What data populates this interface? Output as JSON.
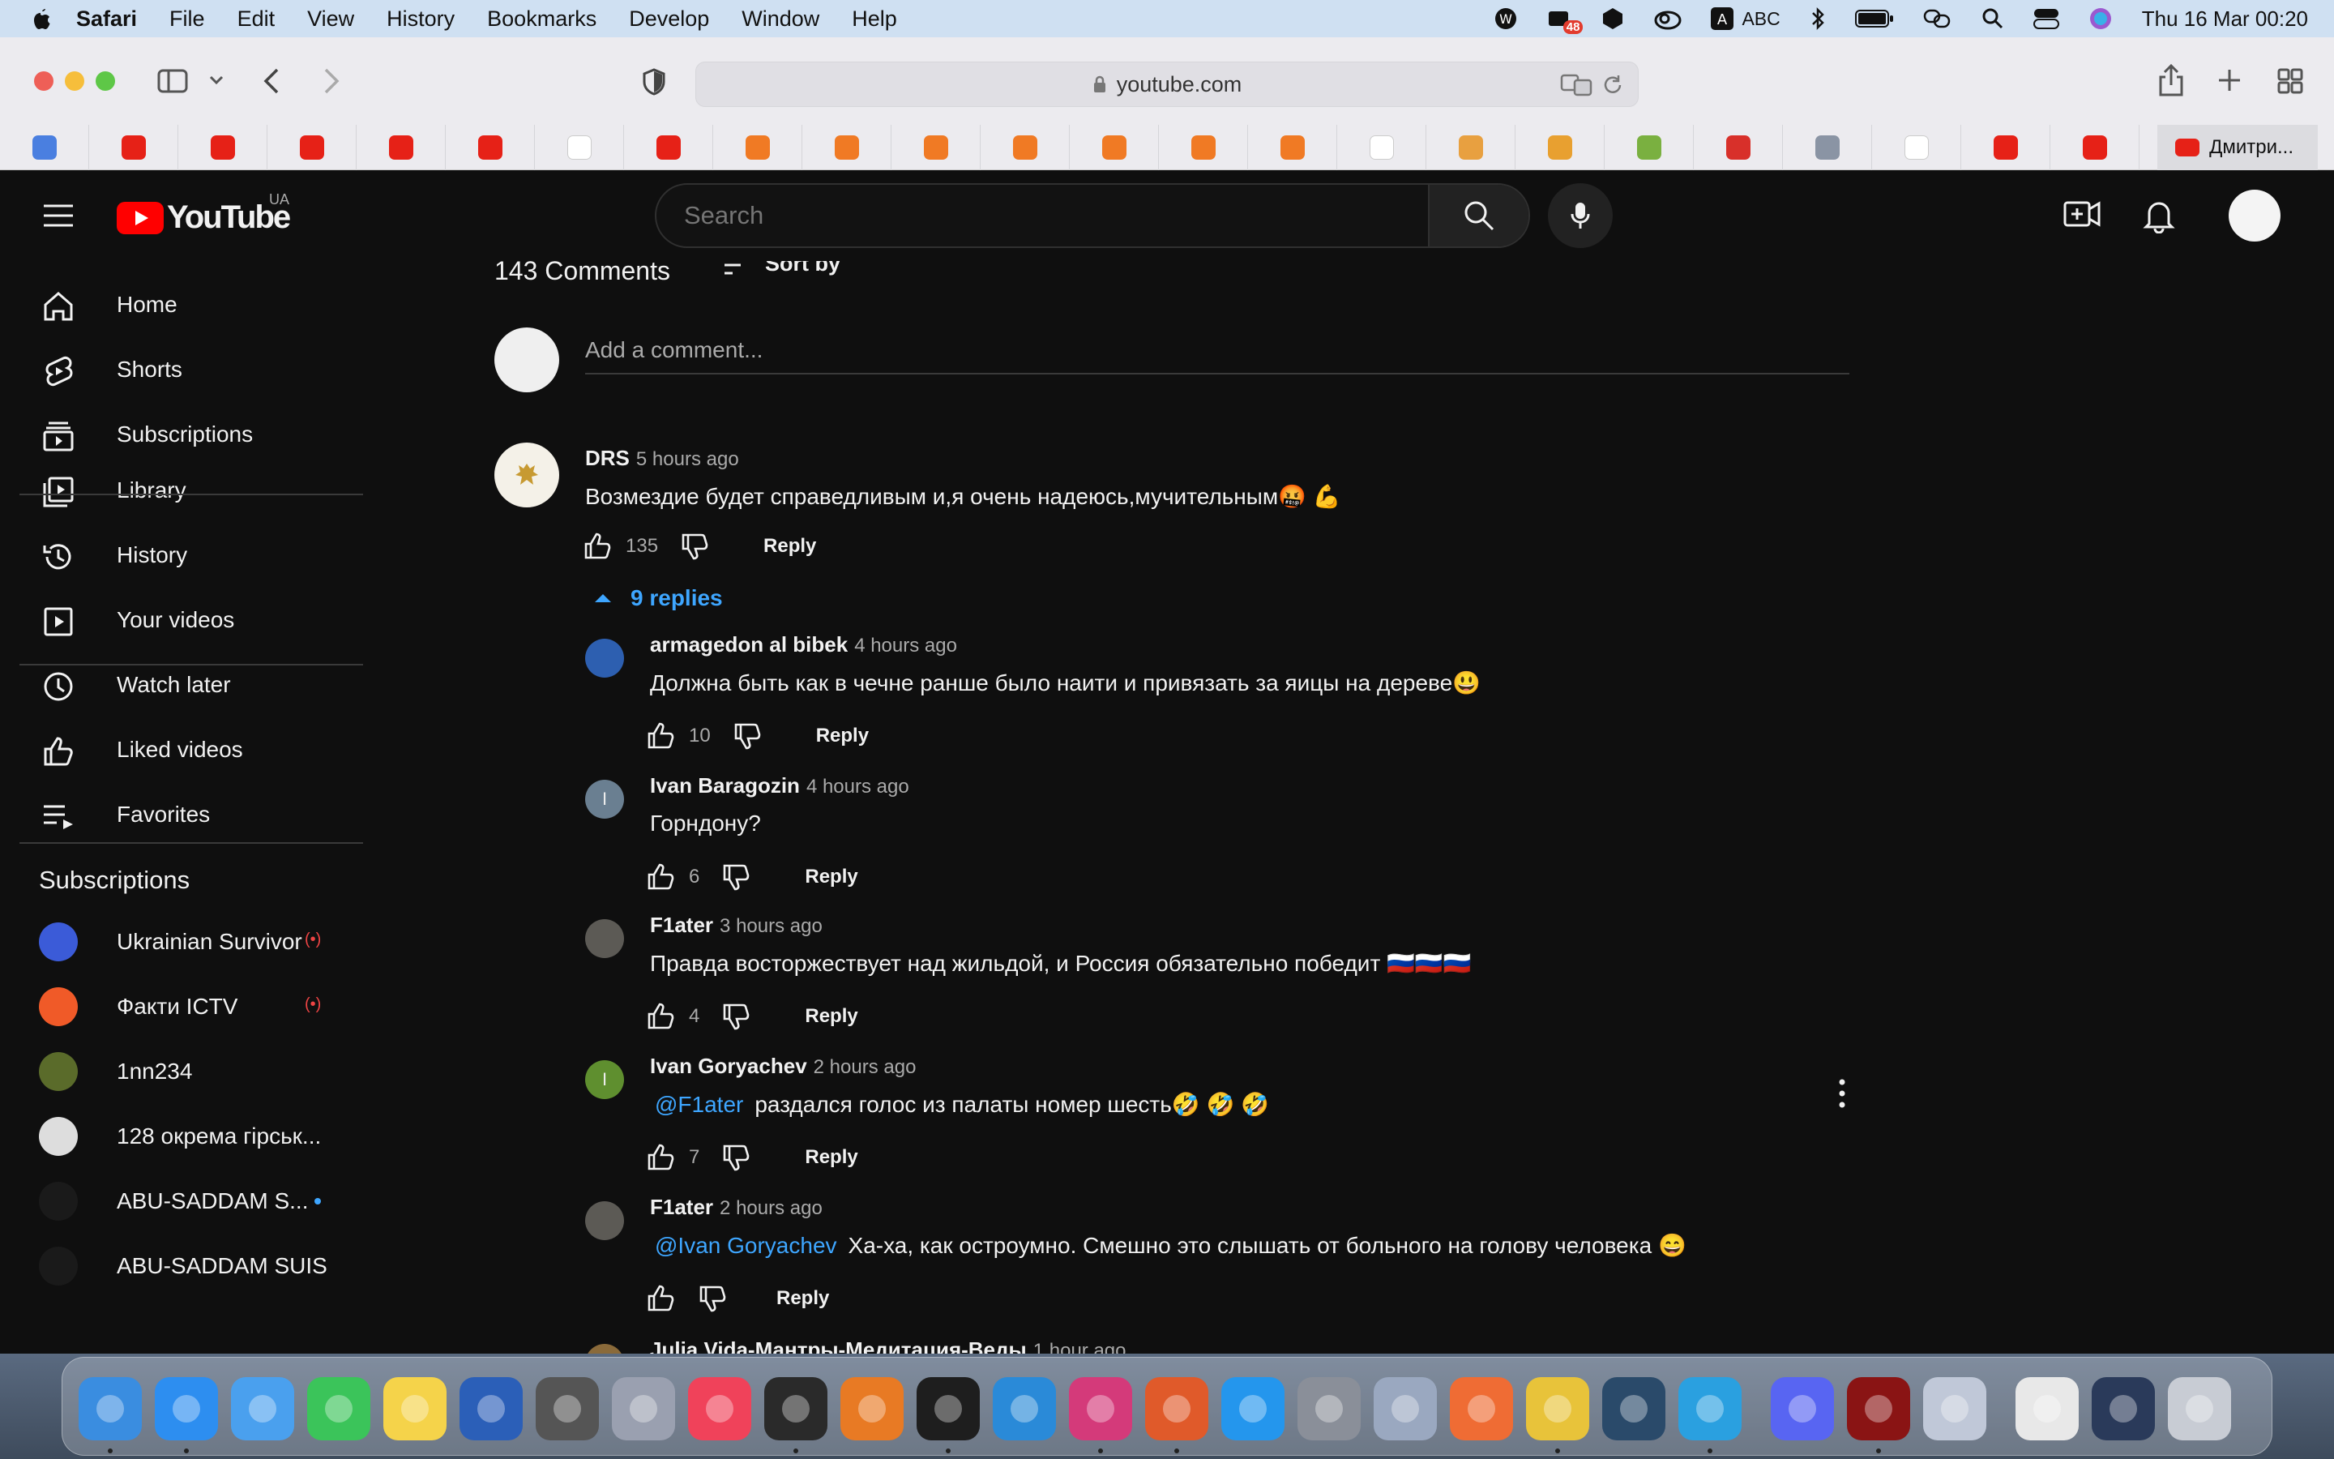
{
  "menubar": {
    "app": "Safari",
    "items": [
      "File",
      "Edit",
      "View",
      "History",
      "Bookmarks",
      "Develop",
      "Window",
      "Help"
    ],
    "keyboard": "ABC",
    "datetime": "Thu 16 Mar  00:20",
    "badge": "48"
  },
  "safari": {
    "url": "youtube.com",
    "bookmark_last": "Дмитри..."
  },
  "yt": {
    "logo": "YouTube",
    "country": "UA",
    "search_placeholder": "Search"
  },
  "sidebar": {
    "main": [
      {
        "label": "Home",
        "icon": "home-icon"
      },
      {
        "label": "Shorts",
        "icon": "shorts-icon"
      },
      {
        "label": "Subscriptions",
        "icon": "subscriptions-icon"
      }
    ],
    "you": [
      {
        "label": "Library",
        "icon": "library-icon"
      },
      {
        "label": "History",
        "icon": "history-icon"
      },
      {
        "label": "Your videos",
        "icon": "your-videos-icon"
      },
      {
        "label": "Watch later",
        "icon": "watch-later-icon"
      },
      {
        "label": "Liked videos",
        "icon": "liked-videos-icon"
      },
      {
        "label": "Favorites",
        "icon": "playlist-icon"
      }
    ],
    "subs_title": "Subscriptions",
    "subs": [
      {
        "label": "Ukrainian Survivor",
        "live": true,
        "color": "#3b5bd8"
      },
      {
        "label": "Факти ICTV",
        "live": true,
        "color": "#f05a28"
      },
      {
        "label": "1nn234",
        "live": false,
        "color": "#5a6b2a"
      },
      {
        "label": "128 окрема гірськ...",
        "live": false,
        "color": "#dddddd"
      },
      {
        "label": "ABU-SADDAM S...",
        "live": false,
        "dot": true,
        "color": "#1a1a1a"
      },
      {
        "label": "ABU-SADDAM SUIS",
        "live": false,
        "color": "#1a1a1a"
      }
    ]
  },
  "comments": {
    "count": "143 Comments",
    "sort": "Sort by",
    "add_placeholder": "Add a comment...",
    "top": {
      "author": "DRS",
      "time": "5 hours ago",
      "text": "Возмездие будет справедливым и,я очень надеюсь,мучительным🤬 💪",
      "likes": "135",
      "reply": "Reply"
    },
    "replies_toggle": "9 replies",
    "replies": [
      {
        "author": "armagedon al bibek",
        "time": "4 hours ago",
        "mention": "",
        "text": "Должна быть как в чечне ранше было наити и привязать за яицы на дереве😃",
        "likes": "10",
        "reply": "Reply",
        "avcolor": "#2d5fb0"
      },
      {
        "author": "Ivan Baragozin",
        "time": "4 hours ago",
        "mention": "",
        "text": "Горндону?",
        "likes": "6",
        "reply": "Reply",
        "avletter": "I",
        "avcolor": "#6a7f91"
      },
      {
        "author": "F1ater",
        "time": "3 hours ago",
        "mention": "",
        "text": "Правда восторжествует над жильдой, и Россия обязательно победит 🇷🇺🇷🇺🇷🇺",
        "likes": "4",
        "reply": "Reply",
        "avcolor": "#5c5a55"
      },
      {
        "author": "Ivan Goryachev",
        "time": "2 hours ago",
        "mention": "@F1ater",
        "text": "раздался голос из палаты номер шесть🤣 🤣 🤣",
        "likes": "7",
        "reply": "Reply",
        "avletter": "I",
        "avcolor": "#5f8f2f"
      },
      {
        "author": "F1ater",
        "time": "2 hours ago",
        "mention": "@Ivan Goryachev",
        "text": "Ха-ха, как остроумно. Смешно это слышать от больного на голову человека 😄",
        "likes": "",
        "reply": "Reply",
        "avcolor": "#5c5a55"
      },
      {
        "author": "Julia Vida-Мантры-Медитация-Веды",
        "time": "1 hour ago",
        "mention": "",
        "text": "",
        "likes": "",
        "reply": "",
        "avcolor": "#8a6a3a"
      }
    ]
  },
  "dock": {
    "apps": [
      {
        "name": "finder",
        "color": "#3a8de0",
        "dot": true
      },
      {
        "name": "safari",
        "color": "#2d8ef0",
        "dot": true
      },
      {
        "name": "mail",
        "color": "#4aa0ee",
        "dot": false
      },
      {
        "name": "facetime",
        "color": "#3bc45a",
        "dot": false
      },
      {
        "name": "notes",
        "color": "#f5d34a",
        "dot": false
      },
      {
        "name": "word",
        "color": "#2b5fb8",
        "dot": false
      },
      {
        "name": "calculator",
        "color": "#555555",
        "dot": false
      },
      {
        "name": "launchpad",
        "color": "#9aa0b0",
        "dot": false
      },
      {
        "name": "music",
        "color": "#f0425a",
        "dot": false
      },
      {
        "name": "wireguard-vpn",
        "color": "#2a2a2a",
        "dot": true
      },
      {
        "name": "sublime-text",
        "color": "#e87a24",
        "dot": false
      },
      {
        "name": "terminal",
        "color": "#1e1e1e",
        "dot": true
      },
      {
        "name": "vscode",
        "color": "#2a8ad8",
        "dot": false
      },
      {
        "name": "intellij",
        "color": "#d43a7a",
        "dot": true
      },
      {
        "name": "firefox",
        "color": "#e05a2a",
        "dot": true
      },
      {
        "name": "docker",
        "color": "#2496ed",
        "dot": false
      },
      {
        "name": "system-settings",
        "color": "#8a8f99",
        "dot": false
      },
      {
        "name": "xcode-tools",
        "color": "#9aa8c0",
        "dot": false
      },
      {
        "name": "postman",
        "color": "#ef6c34",
        "dot": false
      },
      {
        "name": "chrome",
        "color": "#e8c33a",
        "dot": true
      },
      {
        "name": "mysql-workbench",
        "color": "#2a4a6a",
        "dot": false
      },
      {
        "name": "telegram",
        "color": "#2aa0e0",
        "dot": true
      },
      {
        "name": "discord",
        "color": "#5865f2",
        "dot": false
      },
      {
        "name": "flash-player",
        "color": "#8a1414",
        "dot": true
      },
      {
        "name": "preview",
        "color": "#c0c8d8",
        "dot": false
      },
      {
        "name": "archive",
        "color": "#e8e8e8",
        "dot": false
      },
      {
        "name": "screenshot",
        "color": "#2a3a5a",
        "dot": false
      },
      {
        "name": "trash",
        "color": "#c8ccd4",
        "dot": false
      }
    ]
  }
}
